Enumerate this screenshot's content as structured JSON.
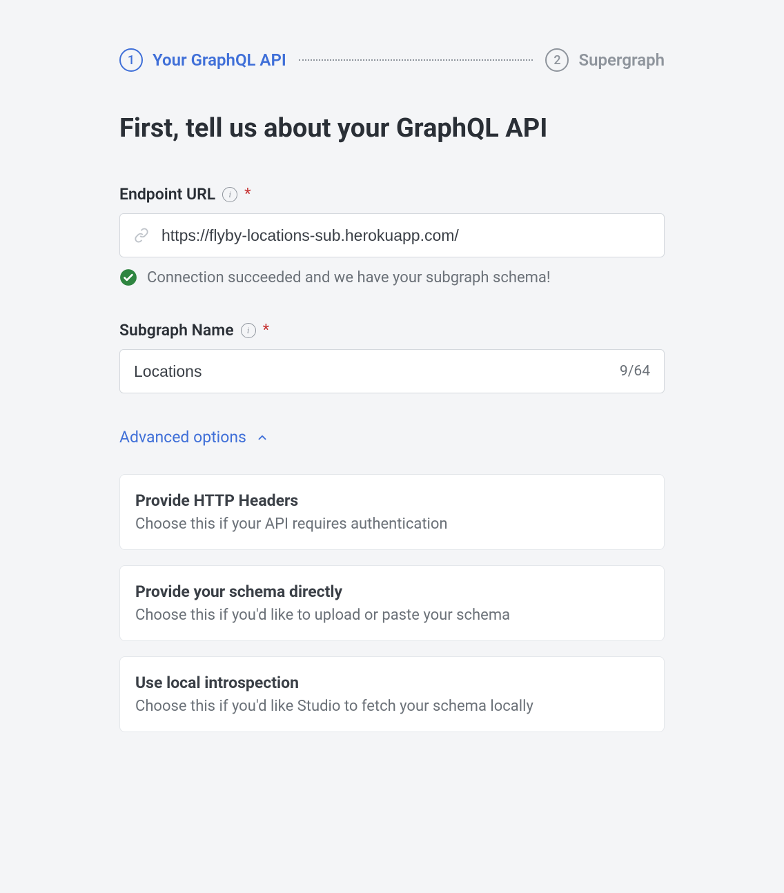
{
  "steps": {
    "step1": {
      "num": "1",
      "label": "Your GraphQL API"
    },
    "step2": {
      "num": "2",
      "label": "Supergraph"
    }
  },
  "heading": "First, tell us about your GraphQL API",
  "endpoint": {
    "label": "Endpoint URL",
    "required": "*",
    "value": "https://flyby-locations-sub.herokuapp.com/",
    "status": "Connection succeeded and we have your subgraph schema!"
  },
  "subgraph": {
    "label": "Subgraph Name",
    "required": "*",
    "value": "Locations",
    "counter": "9/64"
  },
  "advanced": {
    "label": "Advanced options"
  },
  "options": [
    {
      "title": "Provide HTTP Headers",
      "desc": "Choose this if your API requires authentication"
    },
    {
      "title": "Provide your schema directly",
      "desc": "Choose this if you'd like to upload or paste your schema"
    },
    {
      "title": "Use local introspection",
      "desc": "Choose this if you'd like Studio to fetch your schema locally"
    }
  ]
}
